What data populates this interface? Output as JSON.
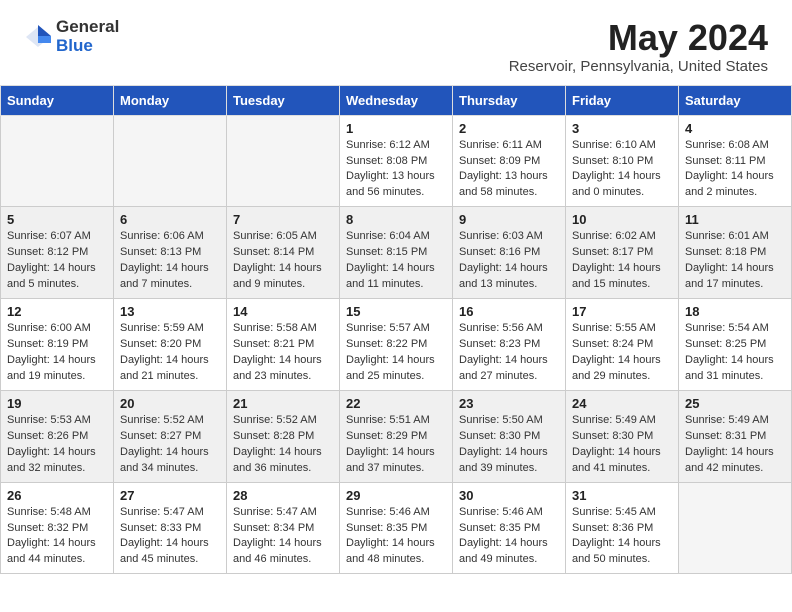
{
  "header": {
    "logo_general": "General",
    "logo_blue": "Blue",
    "title": "May 2024",
    "location": "Reservoir, Pennsylvania, United States"
  },
  "days_of_week": [
    "Sunday",
    "Monday",
    "Tuesday",
    "Wednesday",
    "Thursday",
    "Friday",
    "Saturday"
  ],
  "weeks": [
    {
      "shaded": false,
      "days": [
        {
          "num": "",
          "info": ""
        },
        {
          "num": "",
          "info": ""
        },
        {
          "num": "",
          "info": ""
        },
        {
          "num": "1",
          "info": "Sunrise: 6:12 AM\nSunset: 8:08 PM\nDaylight: 13 hours\nand 56 minutes."
        },
        {
          "num": "2",
          "info": "Sunrise: 6:11 AM\nSunset: 8:09 PM\nDaylight: 13 hours\nand 58 minutes."
        },
        {
          "num": "3",
          "info": "Sunrise: 6:10 AM\nSunset: 8:10 PM\nDaylight: 14 hours\nand 0 minutes."
        },
        {
          "num": "4",
          "info": "Sunrise: 6:08 AM\nSunset: 8:11 PM\nDaylight: 14 hours\nand 2 minutes."
        }
      ]
    },
    {
      "shaded": true,
      "days": [
        {
          "num": "5",
          "info": "Sunrise: 6:07 AM\nSunset: 8:12 PM\nDaylight: 14 hours\nand 5 minutes."
        },
        {
          "num": "6",
          "info": "Sunrise: 6:06 AM\nSunset: 8:13 PM\nDaylight: 14 hours\nand 7 minutes."
        },
        {
          "num": "7",
          "info": "Sunrise: 6:05 AM\nSunset: 8:14 PM\nDaylight: 14 hours\nand 9 minutes."
        },
        {
          "num": "8",
          "info": "Sunrise: 6:04 AM\nSunset: 8:15 PM\nDaylight: 14 hours\nand 11 minutes."
        },
        {
          "num": "9",
          "info": "Sunrise: 6:03 AM\nSunset: 8:16 PM\nDaylight: 14 hours\nand 13 minutes."
        },
        {
          "num": "10",
          "info": "Sunrise: 6:02 AM\nSunset: 8:17 PM\nDaylight: 14 hours\nand 15 minutes."
        },
        {
          "num": "11",
          "info": "Sunrise: 6:01 AM\nSunset: 8:18 PM\nDaylight: 14 hours\nand 17 minutes."
        }
      ]
    },
    {
      "shaded": false,
      "days": [
        {
          "num": "12",
          "info": "Sunrise: 6:00 AM\nSunset: 8:19 PM\nDaylight: 14 hours\nand 19 minutes."
        },
        {
          "num": "13",
          "info": "Sunrise: 5:59 AM\nSunset: 8:20 PM\nDaylight: 14 hours\nand 21 minutes."
        },
        {
          "num": "14",
          "info": "Sunrise: 5:58 AM\nSunset: 8:21 PM\nDaylight: 14 hours\nand 23 minutes."
        },
        {
          "num": "15",
          "info": "Sunrise: 5:57 AM\nSunset: 8:22 PM\nDaylight: 14 hours\nand 25 minutes."
        },
        {
          "num": "16",
          "info": "Sunrise: 5:56 AM\nSunset: 8:23 PM\nDaylight: 14 hours\nand 27 minutes."
        },
        {
          "num": "17",
          "info": "Sunrise: 5:55 AM\nSunset: 8:24 PM\nDaylight: 14 hours\nand 29 minutes."
        },
        {
          "num": "18",
          "info": "Sunrise: 5:54 AM\nSunset: 8:25 PM\nDaylight: 14 hours\nand 31 minutes."
        }
      ]
    },
    {
      "shaded": true,
      "days": [
        {
          "num": "19",
          "info": "Sunrise: 5:53 AM\nSunset: 8:26 PM\nDaylight: 14 hours\nand 32 minutes."
        },
        {
          "num": "20",
          "info": "Sunrise: 5:52 AM\nSunset: 8:27 PM\nDaylight: 14 hours\nand 34 minutes."
        },
        {
          "num": "21",
          "info": "Sunrise: 5:52 AM\nSunset: 8:28 PM\nDaylight: 14 hours\nand 36 minutes."
        },
        {
          "num": "22",
          "info": "Sunrise: 5:51 AM\nSunset: 8:29 PM\nDaylight: 14 hours\nand 37 minutes."
        },
        {
          "num": "23",
          "info": "Sunrise: 5:50 AM\nSunset: 8:30 PM\nDaylight: 14 hours\nand 39 minutes."
        },
        {
          "num": "24",
          "info": "Sunrise: 5:49 AM\nSunset: 8:30 PM\nDaylight: 14 hours\nand 41 minutes."
        },
        {
          "num": "25",
          "info": "Sunrise: 5:49 AM\nSunset: 8:31 PM\nDaylight: 14 hours\nand 42 minutes."
        }
      ]
    },
    {
      "shaded": false,
      "days": [
        {
          "num": "26",
          "info": "Sunrise: 5:48 AM\nSunset: 8:32 PM\nDaylight: 14 hours\nand 44 minutes."
        },
        {
          "num": "27",
          "info": "Sunrise: 5:47 AM\nSunset: 8:33 PM\nDaylight: 14 hours\nand 45 minutes."
        },
        {
          "num": "28",
          "info": "Sunrise: 5:47 AM\nSunset: 8:34 PM\nDaylight: 14 hours\nand 46 minutes."
        },
        {
          "num": "29",
          "info": "Sunrise: 5:46 AM\nSunset: 8:35 PM\nDaylight: 14 hours\nand 48 minutes."
        },
        {
          "num": "30",
          "info": "Sunrise: 5:46 AM\nSunset: 8:35 PM\nDaylight: 14 hours\nand 49 minutes."
        },
        {
          "num": "31",
          "info": "Sunrise: 5:45 AM\nSunset: 8:36 PM\nDaylight: 14 hours\nand 50 minutes."
        },
        {
          "num": "",
          "info": ""
        }
      ]
    }
  ]
}
